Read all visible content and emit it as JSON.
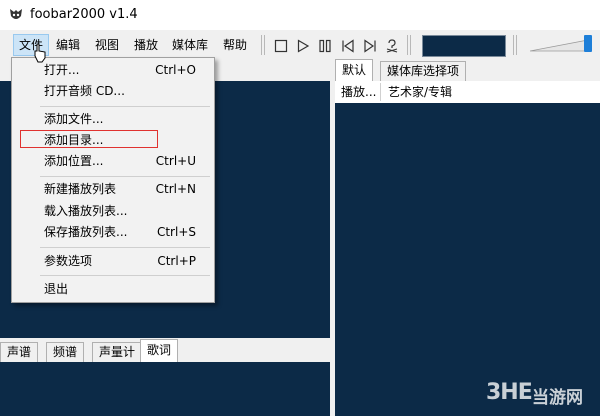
{
  "window": {
    "title": "foobar2000 v1.4"
  },
  "menubar": {
    "items": [
      {
        "label": "文件"
      },
      {
        "label": "编辑"
      },
      {
        "label": "视图"
      },
      {
        "label": "播放"
      },
      {
        "label": "媒体库"
      },
      {
        "label": "帮助"
      }
    ]
  },
  "toolbar": {
    "buttons": [
      "stop-icon",
      "play-icon",
      "pause-icon",
      "previous-icon",
      "next-icon",
      "random-icon"
    ]
  },
  "volume": {
    "level": 0.95
  },
  "file_menu": {
    "items": [
      {
        "label": "打开...",
        "shortcut": "Ctrl+O"
      },
      {
        "label": "打开音频 CD...",
        "shortcut": ""
      },
      {
        "label": "添加文件...",
        "shortcut": ""
      },
      {
        "label": "添加目录...",
        "shortcut": "",
        "highlighted": true
      },
      {
        "label": "添加位置...",
        "shortcut": "Ctrl+U"
      },
      {
        "label": "新建播放列表",
        "shortcut": "Ctrl+N"
      },
      {
        "label": "载入播放列表...",
        "shortcut": ""
      },
      {
        "label": "保存播放列表...",
        "shortcut": "Ctrl+S"
      },
      {
        "label": "参数选项",
        "shortcut": "Ctrl+P"
      },
      {
        "label": "退出",
        "shortcut": ""
      }
    ]
  },
  "right_panel": {
    "tabs": [
      {
        "label": "默认"
      },
      {
        "label": "媒体库选择项"
      }
    ],
    "columns": [
      {
        "label": "播放..."
      },
      {
        "label": "艺术家/专辑"
      }
    ]
  },
  "bottom_panel": {
    "tabs": [
      {
        "label": "声谱"
      },
      {
        "label": "频谱"
      },
      {
        "label": "声量计"
      },
      {
        "label": "歌词"
      }
    ]
  },
  "watermark": {
    "logo": "3HE",
    "text": "当游网"
  },
  "colors": {
    "panel_bg": "#0c2a47",
    "highlight_box": "#e0322f",
    "menu_active": "#cce4f7"
  }
}
